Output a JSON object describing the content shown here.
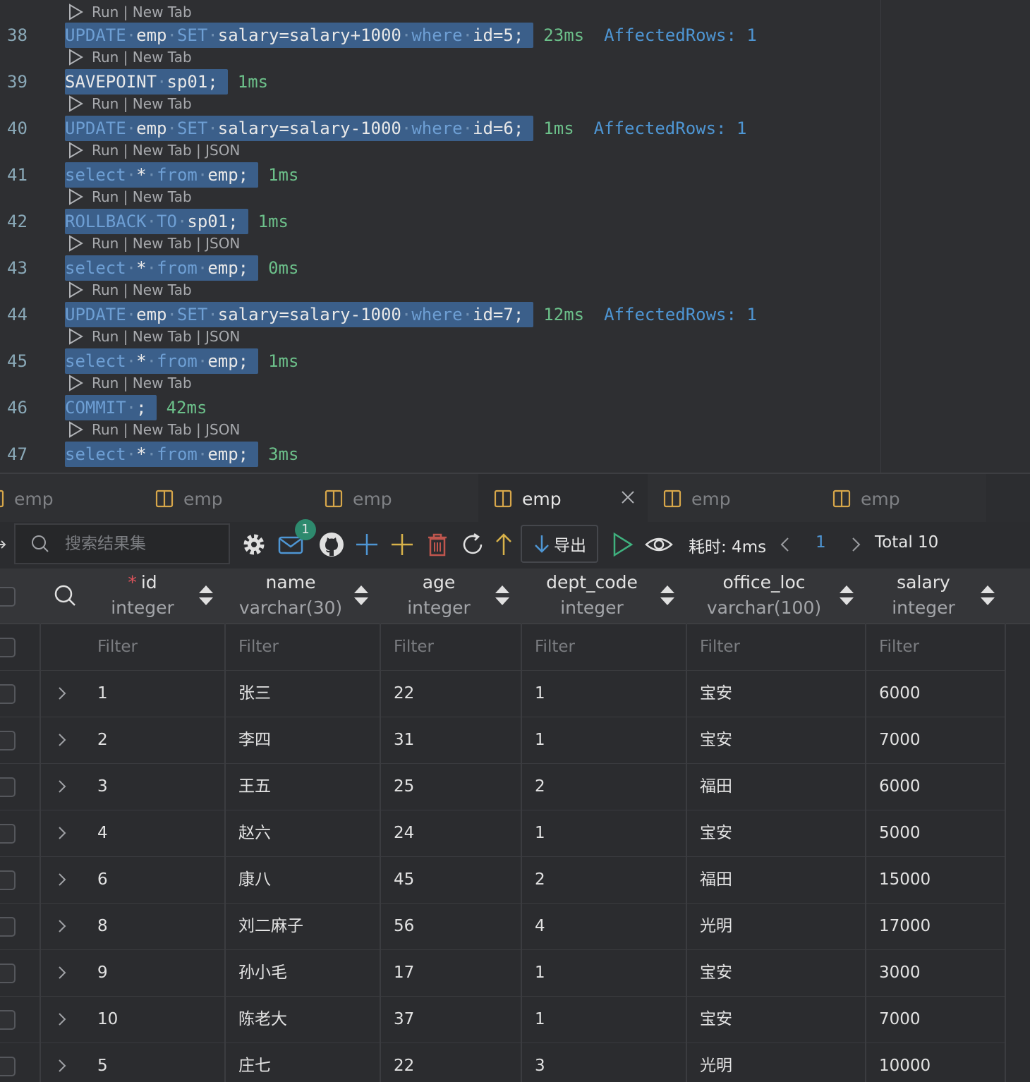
{
  "editor": {
    "lines": [
      {
        "n": "38",
        "lens": "Run | New Tab",
        "kind": "update",
        "value": "salary=salary+1000",
        "id": "5",
        "timing": "23ms",
        "affected": "AffectedRows: 1"
      },
      {
        "n": "39",
        "lens": "Run | New Tab",
        "kind": "savepoint",
        "timing": "1ms"
      },
      {
        "n": "40",
        "lens": "Run | New Tab",
        "kind": "update",
        "value": "salary=salary-1000",
        "id": "6",
        "timing": "1ms",
        "affected": "AffectedRows: 1"
      },
      {
        "n": "41",
        "lens": "Run | New Tab | JSON",
        "kind": "select",
        "timing": "1ms"
      },
      {
        "n": "42",
        "lens": "Run | New Tab",
        "kind": "rollback",
        "timing": "1ms"
      },
      {
        "n": "43",
        "lens": "Run | New Tab | JSON",
        "kind": "select",
        "timing": "0ms"
      },
      {
        "n": "44",
        "lens": "Run | New Tab",
        "kind": "update",
        "value": "salary=salary-1000",
        "id": "7",
        "timing": "12ms",
        "affected": "AffectedRows: 1"
      },
      {
        "n": "45",
        "lens": "Run | New Tab | JSON",
        "kind": "select",
        "timing": "1ms"
      },
      {
        "n": "46",
        "lens": "Run | New Tab",
        "kind": "commit",
        "timing": "42ms"
      },
      {
        "n": "47",
        "lens": "Run | New Tab | JSON",
        "kind": "select",
        "timing": "3ms"
      }
    ],
    "tokens": {
      "update": "UPDATE",
      "emp": "emp",
      "set": "SET",
      "where": "where",
      "id_eq": "id=",
      "savepoint": "SAVEPOINT",
      "sp": "sp01;",
      "select": "select",
      "star": "*",
      "from": "from",
      "emp_semi": "emp;",
      "rollback": "ROLLBACK",
      "to": "TO",
      "commit": "COMMIT",
      "semi": ";"
    },
    "top_lens": "Run | New Tab"
  },
  "tabs": [
    {
      "label": "emp",
      "active": false
    },
    {
      "label": "emp",
      "active": false
    },
    {
      "label": "emp",
      "active": false
    },
    {
      "label": "emp",
      "active": true
    },
    {
      "label": "emp",
      "active": false
    },
    {
      "label": "emp",
      "active": false
    }
  ],
  "toolbar": {
    "search_placeholder": "搜索结果集",
    "badge_count": "1",
    "export_label": "导出",
    "cost_label": "耗时: 4ms",
    "page": "1",
    "total": "Total 10",
    "accent": "#4e96d4",
    "play_color": "#3fb27f",
    "add_color": "#4e96d4",
    "insert_color": "#d8b24a",
    "delete_color": "#c0564e"
  },
  "grid": {
    "columns": [
      {
        "name": "id",
        "type": "integer",
        "required": true
      },
      {
        "name": "name",
        "type": "varchar(30)"
      },
      {
        "name": "age",
        "type": "integer"
      },
      {
        "name": "dept_code",
        "type": "integer"
      },
      {
        "name": "office_loc",
        "type": "varchar(100)"
      },
      {
        "name": "salary",
        "type": "integer"
      }
    ],
    "filter_placeholder": "Filter",
    "rows": [
      [
        "1",
        "张三",
        "22",
        "1",
        "宝安",
        "6000"
      ],
      [
        "2",
        "李四",
        "31",
        "1",
        "宝安",
        "7000"
      ],
      [
        "3",
        "王五",
        "25",
        "2",
        "福田",
        "6000"
      ],
      [
        "4",
        "赵六",
        "24",
        "1",
        "宝安",
        "5000"
      ],
      [
        "6",
        "康八",
        "45",
        "2",
        "福田",
        "15000"
      ],
      [
        "8",
        "刘二麻子",
        "56",
        "4",
        "光明",
        "17000"
      ],
      [
        "9",
        "孙小毛",
        "17",
        "1",
        "宝安",
        "3000"
      ],
      [
        "10",
        "陈老大",
        "37",
        "1",
        "宝安",
        "7000"
      ],
      [
        "5",
        "庄七",
        "22",
        "3",
        "光明",
        "10000"
      ]
    ]
  }
}
